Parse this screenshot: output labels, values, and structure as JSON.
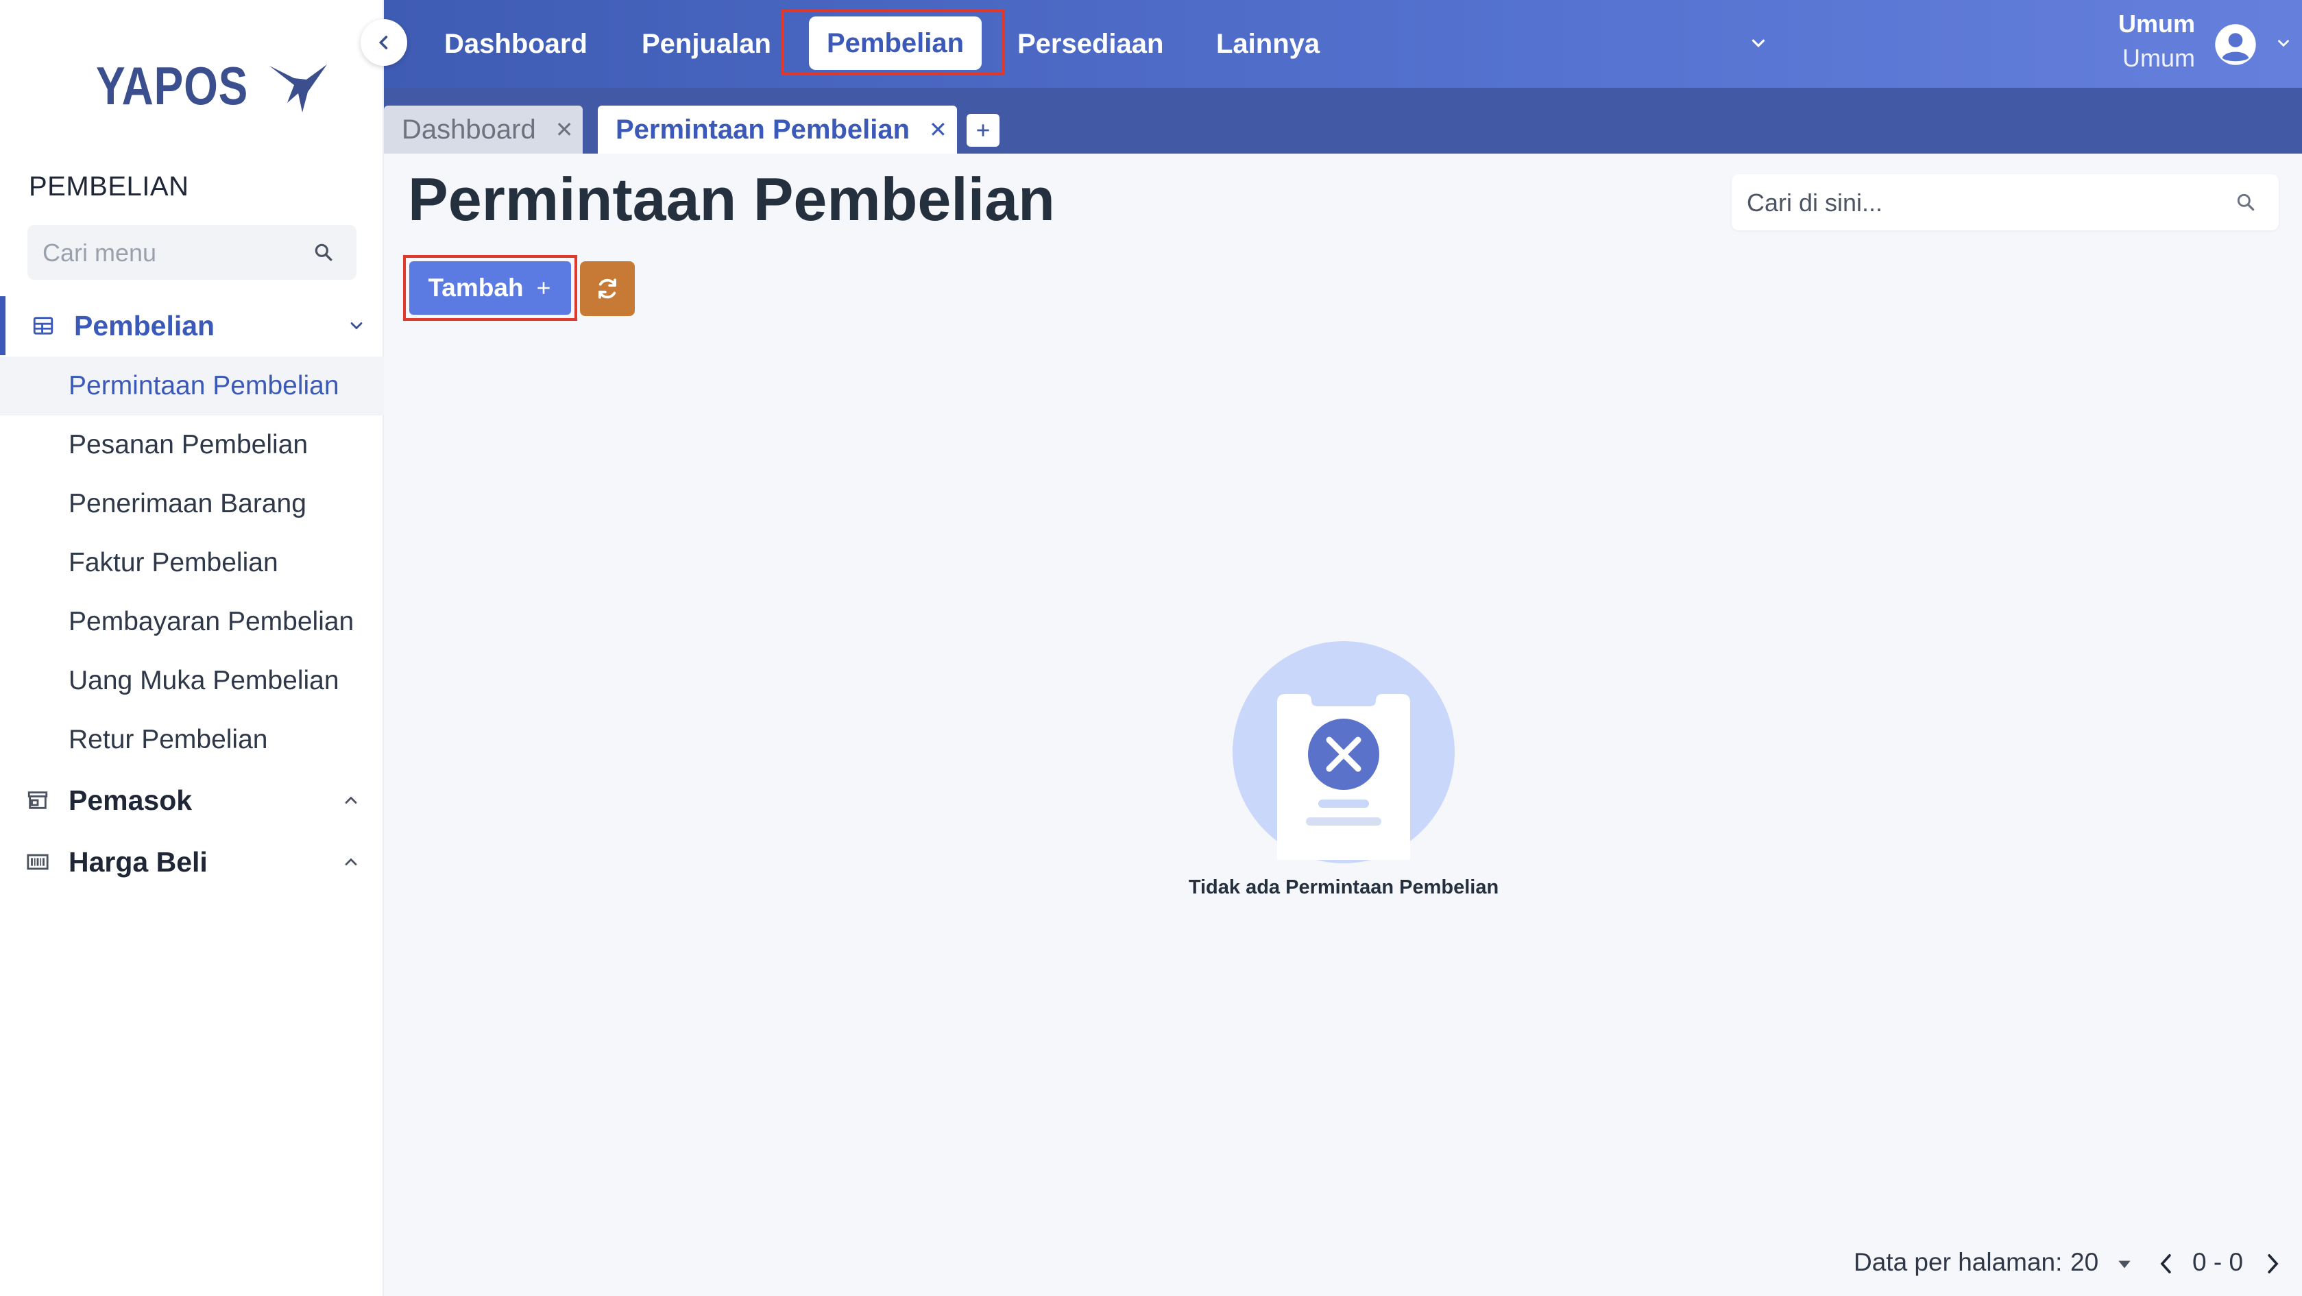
{
  "brand": {
    "name": "YAPOS"
  },
  "sidebar": {
    "section_title": "PEMBELIAN",
    "search_placeholder": "Cari menu",
    "groups": [
      {
        "label": "Pembelian",
        "expanded": true,
        "icon": "table-icon",
        "items": [
          {
            "label": "Permintaan Pembelian",
            "active": true
          },
          {
            "label": "Pesanan Pembelian"
          },
          {
            "label": "Penerimaan Barang"
          },
          {
            "label": "Faktur Pembelian"
          },
          {
            "label": "Pembayaran Pembelian"
          },
          {
            "label": "Uang Muka Pembelian"
          },
          {
            "label": "Retur Pembelian"
          }
        ]
      },
      {
        "label": "Pemasok",
        "expanded": false,
        "icon": "store-icon"
      },
      {
        "label": "Harga Beli",
        "expanded": false,
        "icon": "barcode-icon"
      }
    ]
  },
  "topnav": {
    "items": [
      "Dashboard",
      "Penjualan",
      "Pembelian",
      "Persediaan",
      "Lainnya"
    ],
    "active": "Pembelian"
  },
  "user": {
    "name": "Umum",
    "role": "Umum"
  },
  "tabs": [
    {
      "label": "Dashboard",
      "active": false
    },
    {
      "label": "Permintaan Pembelian",
      "active": true
    }
  ],
  "page": {
    "title": "Permintaan Pembelian",
    "search_placeholder": "Cari di sini...",
    "add_button": "Tambah",
    "empty_message": "Tidak ada Permintaan Pembelian"
  },
  "footer": {
    "per_page_label": "Data per halaman:",
    "per_page_value": "20",
    "range": "0 - 0"
  },
  "colors": {
    "accent": "#3b59b8",
    "primary_button": "#5b7be3",
    "refresh_button": "#c67a35",
    "highlight": "#e0392b"
  }
}
